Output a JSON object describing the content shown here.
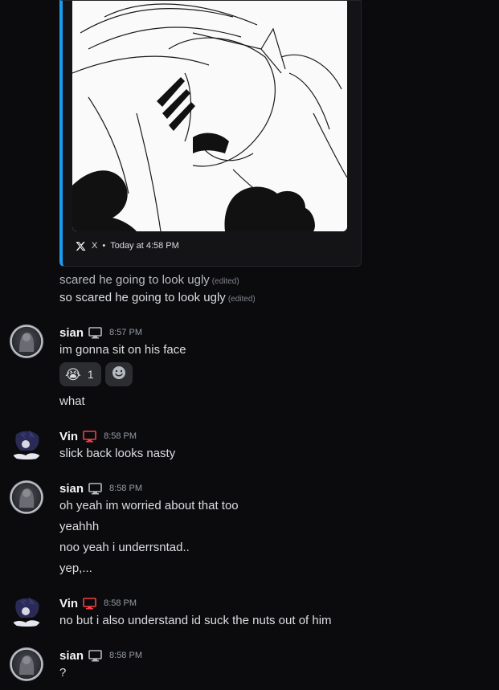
{
  "embed": {
    "source": "X",
    "timestamp": "Today at 4:58 PM",
    "image_icon": "artwork-image"
  },
  "pre_messages": [
    {
      "text": "scared he going to look ugly",
      "edited": "(edited)"
    },
    {
      "text": "so scared he going to look ugly",
      "edited": "(edited)"
    }
  ],
  "groups": [
    {
      "user": "sian",
      "device": "desktop-icon",
      "time": "8:57 PM",
      "lines": [
        "im gonna sit on his face"
      ],
      "reaction": {
        "emoji": "😭",
        "count": "1",
        "add_icon": "add-reaction-icon"
      },
      "after_lines": [
        "what"
      ]
    },
    {
      "user": "Vin",
      "device": "desktop-icon",
      "time": "8:58 PM",
      "lines": [
        "slick back looks nasty"
      ]
    },
    {
      "user": "sian",
      "device": "desktop-icon",
      "time": "8:58 PM",
      "lines": [
        "oh yeah im worried about that too",
        "yeahhh",
        "noo yeah i underrsntad..",
        "yep,..."
      ]
    },
    {
      "user": "Vin",
      "device": "desktop-icon",
      "time": "8:58 PM",
      "lines": [
        "no but i also understand id suck the nuts out of him"
      ]
    },
    {
      "user": "sian",
      "device": "desktop-icon",
      "time": "8:58 PM",
      "lines": [
        "?"
      ]
    }
  ],
  "colors": {
    "background": "#0b0b0d",
    "embed_accent": "#1d9bf0",
    "vin_status": "#f23f43",
    "sian_status": "#b5bac1"
  }
}
